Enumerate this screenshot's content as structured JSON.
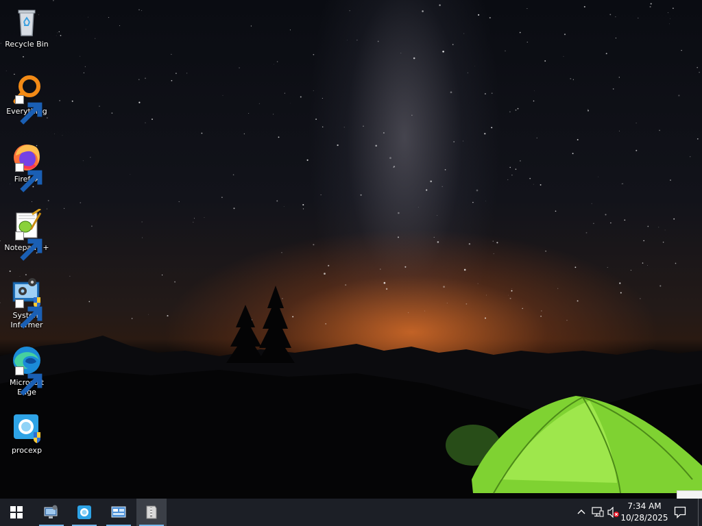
{
  "desktop": {
    "icons": [
      {
        "label": "Recycle Bin",
        "icon": "recycle-bin-icon",
        "shortcut": false
      },
      {
        "label": "Everything",
        "icon": "everything-search-icon",
        "shortcut": true
      },
      {
        "label": "Firefox",
        "icon": "firefox-icon",
        "shortcut": true
      },
      {
        "label": "Notepad++",
        "icon": "notepad-plus-plus-icon",
        "shortcut": true
      },
      {
        "label": "System Informer",
        "icon": "system-informer-icon",
        "shortcut": true
      },
      {
        "label": "Microsoft Edge",
        "icon": "edge-icon",
        "shortcut": true
      },
      {
        "label": "procexp",
        "icon": "process-explorer-icon",
        "shortcut": false
      }
    ]
  },
  "taskbar": {
    "start_icon": "windows-start-icon",
    "pinned": [
      {
        "name": "network-tool",
        "icon": "monitor-network-icon",
        "running": true
      },
      {
        "name": "process-explorer",
        "icon": "process-explorer-icon",
        "running": true
      },
      {
        "name": "control-panel",
        "icon": "control-panel-icon",
        "running": true
      },
      {
        "name": "archive-tool",
        "icon": "archive-icon",
        "running": true,
        "active": true
      }
    ],
    "tray": {
      "icons": [
        "chevron-up-icon",
        "network-icon",
        "volume-muted-icon"
      ],
      "time": "7:34 AM",
      "date": "10/28/2025"
    },
    "notification_icon": "action-center-icon"
  },
  "colors": {
    "taskbar_bg": "#1c1f26",
    "accent": "#76b9ed",
    "tent_green": "#8ee23a",
    "horizon_orange": "#dc6e28"
  }
}
